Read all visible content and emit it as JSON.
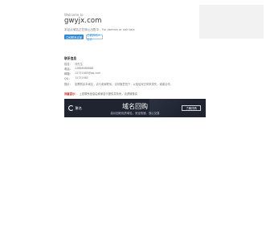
{
  "header": {
    "welcome": "Welcome to",
    "domain": "gwyjx.com",
    "description": "本站点域名正在转让出售中，For domain or sell sale.",
    "primary_button": "立即联系买家",
    "secondary_button": "已被其他人出价"
  },
  "info": {
    "title": "联系信息",
    "rows": [
      {
        "label": "姓名：",
        "value": "刘先生"
      },
      {
        "label": "电话：",
        "value": "13888888888"
      },
      {
        "label": "邮箱：",
        "value": "15731985@qq.com"
      },
      {
        "label": "QQ：",
        "value": "15731985"
      },
      {
        "label": "提示：",
        "value": "如需购买本域名，请与卖家联系，请勿随意拍下，以免给双方带来损失，谢谢合作。"
      }
    ],
    "notice_tag": "郑重提示：",
    "notice_text": "上述联系信息由卖家自行提供并负责，请谨慎核实"
  },
  "banner": {
    "logo_text": "聚名",
    "title": "域名回购",
    "subtitle": "高价回收优质域名，安全快速，放心交易",
    "button": "了解详情"
  }
}
